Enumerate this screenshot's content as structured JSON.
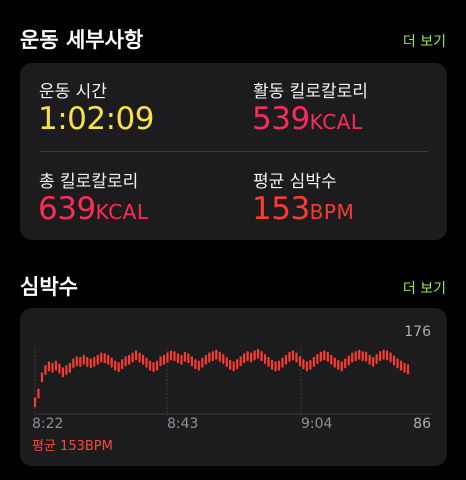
{
  "workout_details": {
    "title": "운동 세부사항",
    "more_label": "더 보기",
    "metrics": [
      {
        "label": "운동 시간",
        "value": "1:02:09",
        "unit": "",
        "color": "#fde047"
      },
      {
        "label": "활동 킬로칼로리",
        "value": "539",
        "unit": "KCAL",
        "color": "#ff2d55"
      },
      {
        "label": "총 킬로칼로리",
        "value": "639",
        "unit": "KCAL",
        "color": "#ff2d55"
      },
      {
        "label": "평균 심박수",
        "value": "153",
        "unit": "BPM",
        "color": "#ff3b30"
      }
    ]
  },
  "heart_rate": {
    "title": "심박수",
    "more_label": "더 보기",
    "y_max_label": "176",
    "y_min_label": "86",
    "average_label": "평균 153BPM",
    "x_labels": [
      "8:22",
      "8:43",
      "9:04"
    ],
    "line_color": "#ff3b30"
  },
  "chart_data": {
    "type": "line",
    "title": "",
    "xlabel": "",
    "ylabel": "",
    "ylim": [
      86,
      176
    ],
    "x_tick_labels": [
      "8:22",
      "8:43",
      "9:04"
    ],
    "series": [
      {
        "values": [
          102,
          114,
          136,
          146,
          151,
          149,
          152,
          148,
          143,
          146,
          149,
          155,
          158,
          157,
          160,
          157,
          155,
          157,
          160,
          163,
          162,
          160,
          156,
          152,
          150,
          154,
          158,
          160,
          163,
          166,
          163,
          160,
          156,
          152,
          150,
          152,
          158,
          160,
          163,
          166,
          165,
          162,
          160,
          164,
          162,
          158,
          154,
          152,
          156,
          160,
          163,
          165,
          167,
          164,
          161,
          157,
          153,
          151,
          154,
          158,
          162,
          165,
          163,
          166,
          168,
          165,
          161,
          157,
          153,
          151,
          152,
          156,
          160,
          164,
          166,
          163,
          158,
          154,
          151,
          153,
          157,
          161,
          164,
          166,
          164,
          160,
          156,
          153,
          151,
          155,
          159,
          163,
          165,
          167,
          165,
          164,
          160,
          157,
          161,
          165,
          167,
          166,
          163,
          159,
          155,
          152,
          149,
          147
        ]
      }
    ]
  }
}
